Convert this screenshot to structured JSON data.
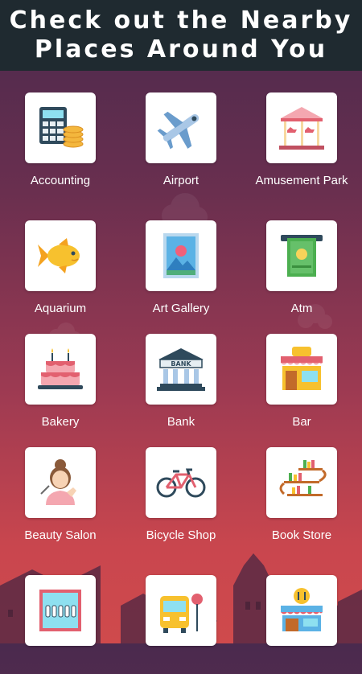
{
  "header": {
    "line1": "Check out the Nearby",
    "line2": "Places Around You"
  },
  "places": [
    {
      "label": "Accounting",
      "icon": "calculator-coins-icon"
    },
    {
      "label": "Airport",
      "icon": "airplane-icon"
    },
    {
      "label": "Amusement Park",
      "icon": "carousel-icon"
    },
    {
      "label": "Aquarium",
      "icon": "goldfish-icon"
    },
    {
      "label": "Art Gallery",
      "icon": "framed-picture-icon"
    },
    {
      "label": "Atm",
      "icon": "cash-dispense-icon"
    },
    {
      "label": "Bakery",
      "icon": "cake-icon"
    },
    {
      "label": "Bank",
      "icon": "bank-building-icon"
    },
    {
      "label": "Bar",
      "icon": "bar-storefront-icon"
    },
    {
      "label": "Beauty Salon",
      "icon": "woman-makeup-icon"
    },
    {
      "label": "Bicycle Shop",
      "icon": "bicycle-icon"
    },
    {
      "label": "Book Store",
      "icon": "bookshelf-icon"
    },
    {
      "label": "",
      "icon": "bowling-alley-icon"
    },
    {
      "label": "",
      "icon": "bus-station-icon"
    },
    {
      "label": "",
      "icon": "cafe-storefront-icon"
    }
  ]
}
